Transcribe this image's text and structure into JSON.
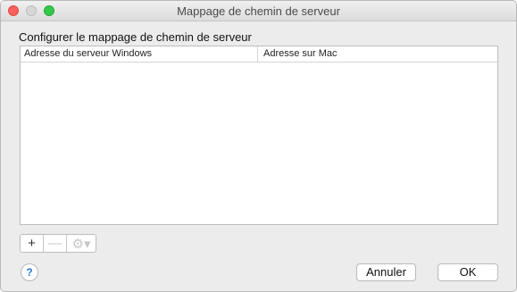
{
  "window": {
    "title": "Mappage de chemin de serveur"
  },
  "main": {
    "heading": "Configurer le mappage de chemin de serveur",
    "table": {
      "columns": [
        "Adresse du serveur Windows",
        "Adresse sur Mac"
      ],
      "rows": []
    }
  },
  "toolbar": {
    "add_label": "+",
    "remove_label": "—",
    "gear_label": "⚙▾"
  },
  "footer": {
    "help_label": "?",
    "cancel_label": "Annuler",
    "ok_label": "OK"
  },
  "colors": {
    "close": "#fc605c",
    "minimize_disabled": "#d7d7d7",
    "zoom": "#34c84a",
    "help_accent": "#2f7bdc"
  }
}
